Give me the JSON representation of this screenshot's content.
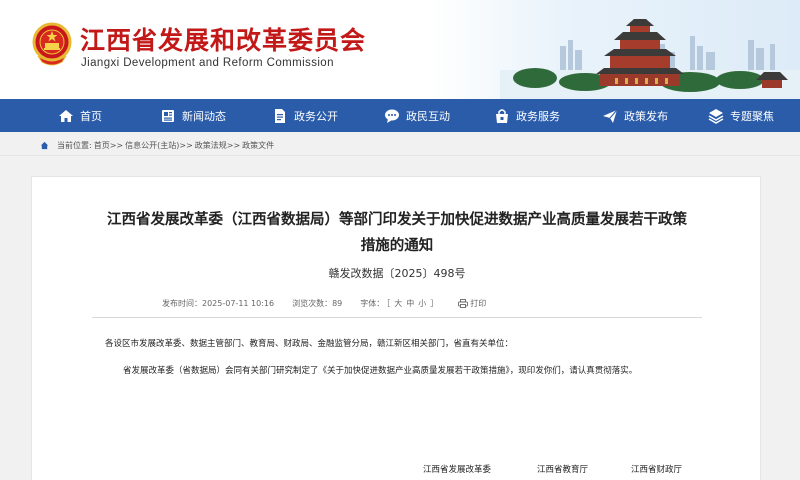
{
  "header": {
    "title_cn": "江西省发展和改革委员会",
    "title_en": "Jiangxi Development and Reform Commission"
  },
  "nav": {
    "items": [
      {
        "label": "首页",
        "icon": "home-icon"
      },
      {
        "label": "新闻动态",
        "icon": "news-icon"
      },
      {
        "label": "政务公开",
        "icon": "document-icon"
      },
      {
        "label": "政民互动",
        "icon": "chat-icon"
      },
      {
        "label": "政务服务",
        "icon": "service-icon"
      },
      {
        "label": "政策发布",
        "icon": "send-icon"
      },
      {
        "label": "专题聚焦",
        "icon": "layers-icon"
      }
    ]
  },
  "breadcrumb": {
    "prefix": "当前位置:",
    "items": [
      "首页",
      "信息公开(主站)",
      "政策法规",
      "政策文件"
    ],
    "separator": ">>"
  },
  "article": {
    "title_line1": "江西省发展改革委（江西省数据局）等部门印发关于加快促进数据产业高质量发展若干政策",
    "title_line2": "措施的通知",
    "doc_number": "赣发改数据〔2025〕498号",
    "publish_label": "发布时间：",
    "publish_time": "2025-07-11 10:16",
    "views_label": "浏览次数：",
    "views": "89",
    "font_label": "字体：",
    "font_open": "［",
    "font_large": "大",
    "font_medium": "中",
    "font_small": "小",
    "font_close": "］",
    "print_label": "打印",
    "greeting": "各设区市发展改革委、数据主管部门、教育局、财政局、金融监管分局，赣江新区相关部门，省直有关单位：",
    "body": "省发展改革委（省数据局）会同有关部门研究制定了《关于加快促进数据产业高质量发展若干政策措施》，现印发你们，请认真贯彻落实。",
    "signatories": [
      "江西省发展改革委",
      "江西省教育厅",
      "江西省财政厅"
    ]
  },
  "colors": {
    "brand_red": "#c21818",
    "nav_blue": "#2a5caa"
  }
}
